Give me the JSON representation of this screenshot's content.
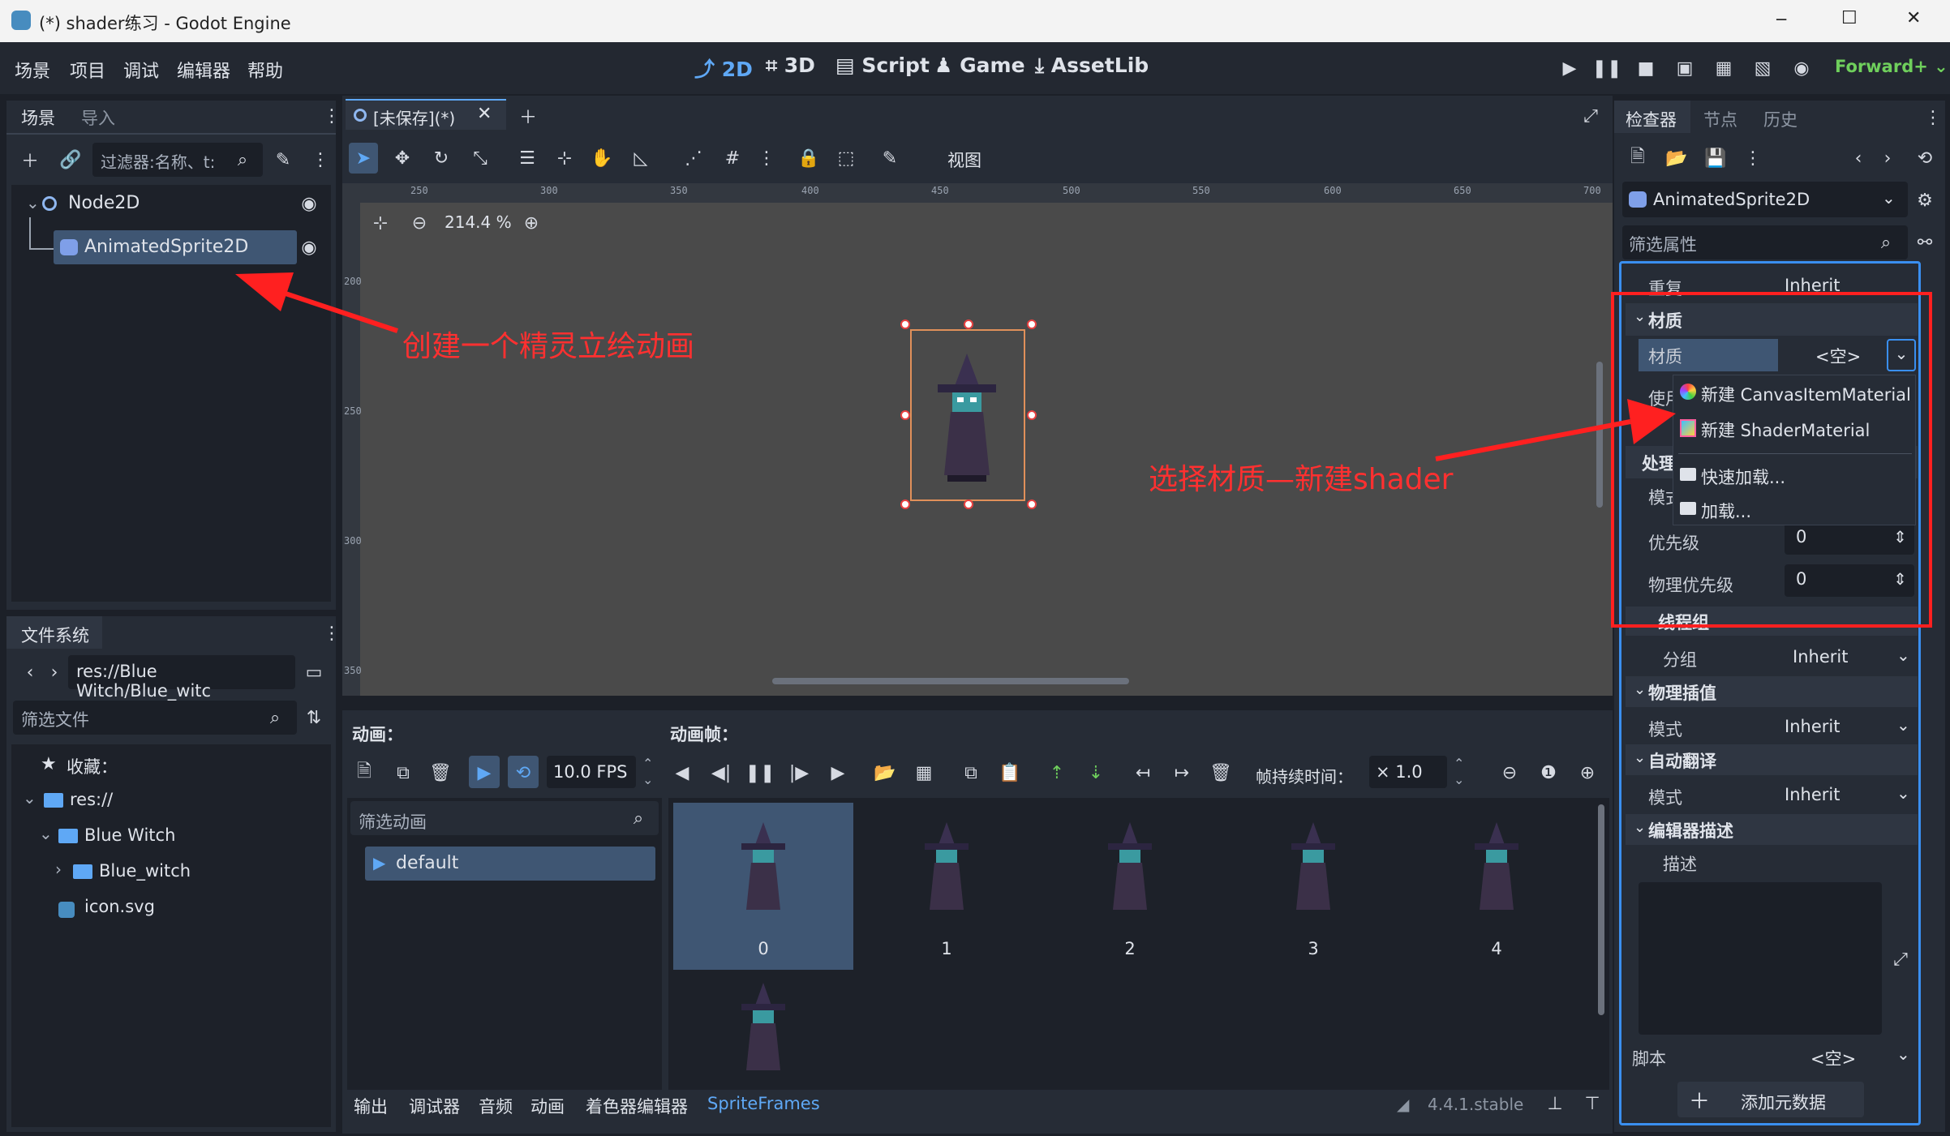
{
  "window": {
    "title": "(*) shader练习 - Godot Engine",
    "min": "─",
    "max": "☐",
    "close": "✕"
  },
  "menu": [
    "场景",
    "项目",
    "调试",
    "编辑器",
    "帮助"
  ],
  "workspaces": {
    "d2": "2D",
    "d3": "3D",
    "script": "Script",
    "game": "Game",
    "assetlib": "AssetLib"
  },
  "renderer": "Forward+",
  "scene_dock": {
    "tab_scene": "场景",
    "tab_import": "导入",
    "filter_placeholder": "过滤器:名称、t:",
    "nodes": [
      {
        "name": "Node2D"
      },
      {
        "name": "AnimatedSprite2D"
      }
    ]
  },
  "filesystem": {
    "tab": "文件系统",
    "path": "res://Blue Witch/Blue_witc",
    "filter_placeholder": "筛选文件",
    "items": {
      "favorites": "收藏：",
      "res": "res://",
      "blue_witch": "Blue Witch",
      "blue_witch_sub": "Blue_witch",
      "icon": "icon.svg"
    }
  },
  "editor": {
    "tab_label": "[未保存](*)",
    "view_menu": "视图",
    "zoom": "214.4 %",
    "ruler": [
      "250",
      "300",
      "350",
      "400",
      "450",
      "500",
      "550",
      "600",
      "650",
      "700"
    ],
    "vruler": [
      "200",
      "250",
      "300",
      "350"
    ]
  },
  "annotations": {
    "sprite": "创建一个精灵立绘动画",
    "shader": "选择材质—新建shader"
  },
  "animation": {
    "anim_label": "动画：",
    "frames_label": "动画帧：",
    "fps": "10.0 FPS",
    "duration_label": "帧持续时间：",
    "duration": "× 1.0",
    "filter_placeholder": "筛选动画",
    "default": "default",
    "frames": [
      "0",
      "1",
      "2",
      "3",
      "4"
    ]
  },
  "bottom_bar": {
    "tabs": [
      "输出",
      "调试器",
      "音频",
      "动画",
      "着色器编辑器"
    ],
    "active": "SpriteFrames",
    "version": "4.4.1.stable"
  },
  "inspector": {
    "tabs": [
      "检查器",
      "节点",
      "历史"
    ],
    "node": "AnimatedSprite2D",
    "filter_placeholder": "筛选属性",
    "repeat_label": "重复",
    "repeat_val": "Inherit",
    "material_section": "材质",
    "material_label": "材质",
    "material_val": "<空>",
    "use_label": "使用",
    "process_section": "处理",
    "mode_label": "模式",
    "priority_label": "优先级",
    "priority_val": "0",
    "physics_priority_label": "物理优先级",
    "physics_priority_val": "0",
    "thread_section": "线程组",
    "group_label": "分组",
    "group_val": "Inherit",
    "physics_interp_section": "物理插值",
    "physics_mode_label": "模式",
    "physics_mode_val": "Inherit",
    "auto_translate_section": "自动翻译",
    "auto_mode_label": "模式",
    "auto_mode_val": "Inherit",
    "editor_desc_section": "编辑器描述",
    "desc_label": "描述",
    "script_label": "脚本",
    "script_val": "<空>",
    "add_metadata": "添加元数据"
  },
  "dropdown": {
    "items": [
      "新建 CanvasItemMaterial",
      "新建 ShaderMaterial",
      "快速加载...",
      "加载..."
    ]
  },
  "colors": {
    "accent": "#5fa8f5",
    "annotation": "#ff3030",
    "selected": "#3f5673"
  }
}
